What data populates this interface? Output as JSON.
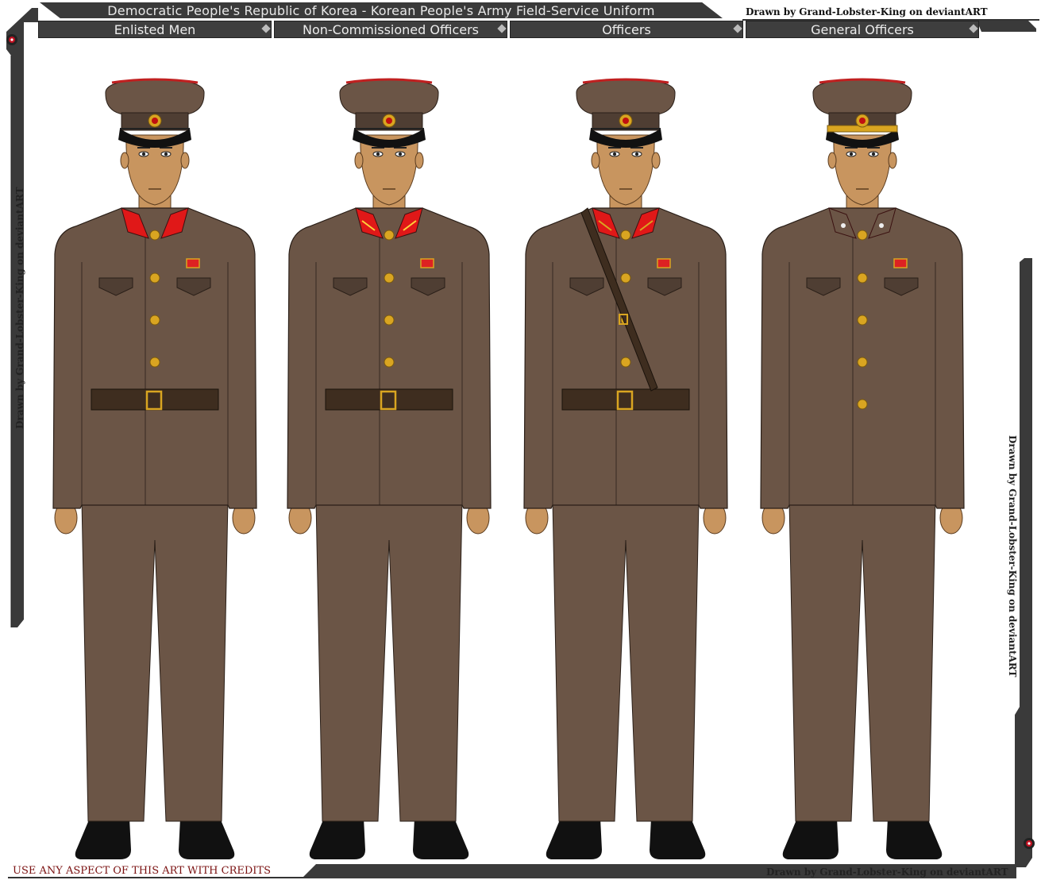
{
  "header": {
    "title": "Democratic People's Republic of Korea - Korean People's Army Field-Service Uniform",
    "credit": "Drawn by Grand-Lobster-King on deviantART"
  },
  "tabs": [
    {
      "label": "Enlisted Men"
    },
    {
      "label": "Non-Commissioned Officers"
    },
    {
      "label": "Officers"
    },
    {
      "label": "General Officers"
    }
  ],
  "side_credits": {
    "left": "Drawn by Grand-Lobster-King on deviantART",
    "right": "Drawn by Grand-Lobster-King on deviantART"
  },
  "footer": {
    "usage_notice": "USE ANY ASPECT OF THIS ART WITH CREDITS",
    "credit": "Drawn by Grand-Lobster-King on deviantART"
  },
  "colors": {
    "uniform": "#6b5546",
    "uniform_dark": "#4f3e33",
    "skin": "#c8955f",
    "belt": "#3e2d1f",
    "collar_red": "#e01818",
    "gold": "#d9a521",
    "frame": "#3a3a3a"
  },
  "figures": [
    {
      "rank": "Enlisted Men",
      "collar": "red",
      "has_strap": false,
      "has_belt": true,
      "gold_cord": false
    },
    {
      "rank": "Non-Commissioned Officers",
      "collar": "red-striped",
      "has_strap": false,
      "has_belt": true,
      "gold_cord": false
    },
    {
      "rank": "Officers",
      "collar": "gold-red",
      "has_strap": true,
      "has_belt": true,
      "gold_cord": false
    },
    {
      "rank": "General Officers",
      "collar": "stars",
      "has_strap": false,
      "has_belt": false,
      "gold_cord": true
    }
  ]
}
